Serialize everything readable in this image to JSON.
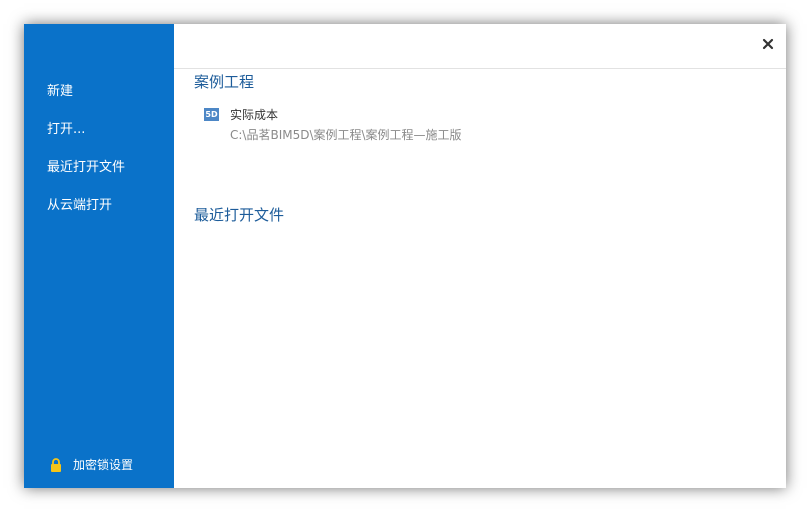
{
  "sidebar": {
    "items": [
      {
        "label": "新建"
      },
      {
        "label": "打开..."
      },
      {
        "label": "最近打开文件"
      },
      {
        "label": "从云端打开"
      }
    ],
    "lock_label": "加密锁设置",
    "color": "#0a72c9"
  },
  "main": {
    "sample_section_title": "案例工程",
    "sample_projects": [
      {
        "badge": "5D",
        "name": "实际成本",
        "path": "C:\\品茗BIM5D\\案例工程\\案例工程—施工版"
      }
    ],
    "recent_section_title": "最近打开文件",
    "title_color": "#1d5c9a"
  },
  "icons": {
    "close": "close-icon",
    "lock": "lock-icon",
    "badge": "5d-badge-icon"
  }
}
